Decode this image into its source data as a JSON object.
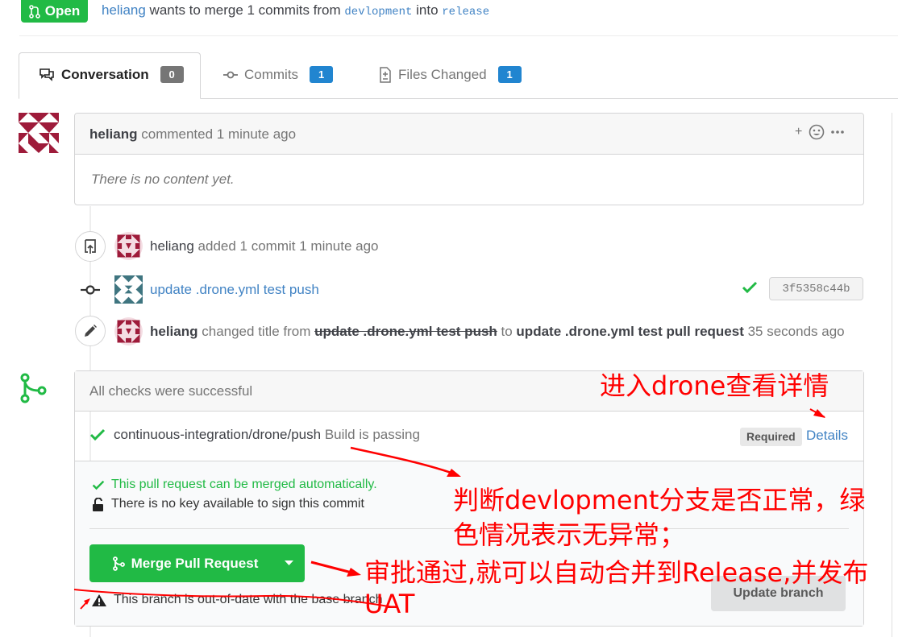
{
  "header": {
    "status": "Open",
    "author": "heliang",
    "text_mid": " wants to merge 1 commits from ",
    "head_branch": "devlopment",
    "text_into": " into ",
    "base_branch": "release"
  },
  "tabs": [
    {
      "label": "Conversation",
      "count": "0",
      "active": true,
      "icon": "comment-icon"
    },
    {
      "label": "Commits",
      "count": "1",
      "active": false,
      "icon": "commit-icon"
    },
    {
      "label": "Files Changed",
      "count": "1",
      "active": false,
      "icon": "file-diff-icon"
    }
  ],
  "comment": {
    "author": "heliang",
    "action": " commented ",
    "time": "1 minute ago",
    "body": "There is no content yet.",
    "add_label": "+"
  },
  "events": {
    "added": {
      "author": "heliang",
      "text": " added 1 commit 1 minute ago"
    },
    "commit": {
      "message": "update .drone.yml test push",
      "sha": "3f5358c44b"
    },
    "retitle": {
      "author": "heliang",
      "text1": " changed title from ",
      "old_title": "update .drone.yml test push",
      "text2": " to ",
      "new_title": "update .drone.yml test pull request",
      "time": " 35 seconds ago"
    }
  },
  "checks": {
    "title": "All checks were successful",
    "context": "continuous-integration/drone/push",
    "description": "Build is passing",
    "required_label": "Required",
    "details_label": "Details"
  },
  "merge": {
    "can_merge": "This pull request can be merged automatically.",
    "no_key": "There is no key available to sign this commit",
    "button": "Merge Pull Request",
    "outdated": "This branch is out-of-date with the base branch",
    "update_button": "Update branch"
  },
  "annotations": {
    "details_note": "进入drone查看详情",
    "check_note_1": "判断devlopment分支是否正常，绿",
    "check_note_2": "色情况表示无异常；",
    "merge_note_1": "审批通过,就可以自动合并到Release,并发布",
    "merge_note_2": "UAT"
  },
  "colors": {
    "accent_green": "#21ba45",
    "link_blue": "#4183c4",
    "label_blue": "#2185d0",
    "annotation_red": "#ff0000",
    "avatar_red": "#9e1b3a",
    "avatar_teal": "#3f7580"
  }
}
